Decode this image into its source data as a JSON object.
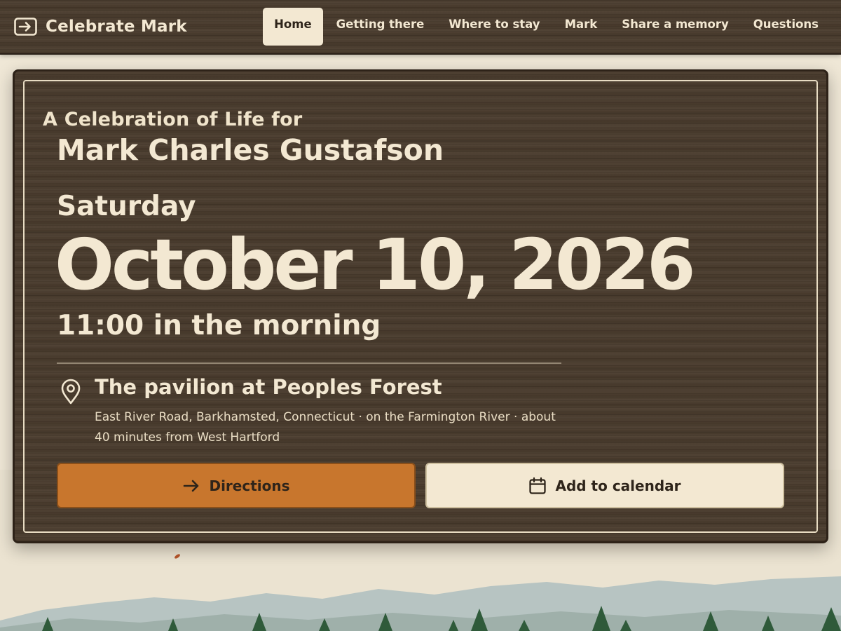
{
  "brand": {
    "title": "Celebrate Mark",
    "icon": "enter-arrow-icon"
  },
  "nav": {
    "items": [
      {
        "label": "Home",
        "active": true
      },
      {
        "label": "Getting there",
        "active": false
      },
      {
        "label": "Where to stay",
        "active": false
      },
      {
        "label": "Mark",
        "active": false
      },
      {
        "label": "Share a memory",
        "active": false
      },
      {
        "label": "Questions",
        "active": false
      }
    ]
  },
  "hero": {
    "eyebrow": "A Celebration of Life for",
    "name": "Mark Charles Gustafson",
    "weekday": "Saturday",
    "date": "October 10, 2026",
    "time": "11:00 in the morning",
    "venue": "The pavilion at Peoples Forest",
    "address": "East River Road, Barkhamsted, Connecticut · on the Farmington River · about 40 minutes from West Hartford",
    "venue_icon": "map-pin-icon"
  },
  "actions": {
    "directions_label": "Directions",
    "directions_icon": "arrow-right-icon",
    "calendar_label": "Add to calendar",
    "calendar_icon": "calendar-icon"
  },
  "colors": {
    "wood": "#4a3b2c",
    "cream": "#f3e8d2",
    "accent": "#c8762d",
    "background": "#efe7d6"
  }
}
